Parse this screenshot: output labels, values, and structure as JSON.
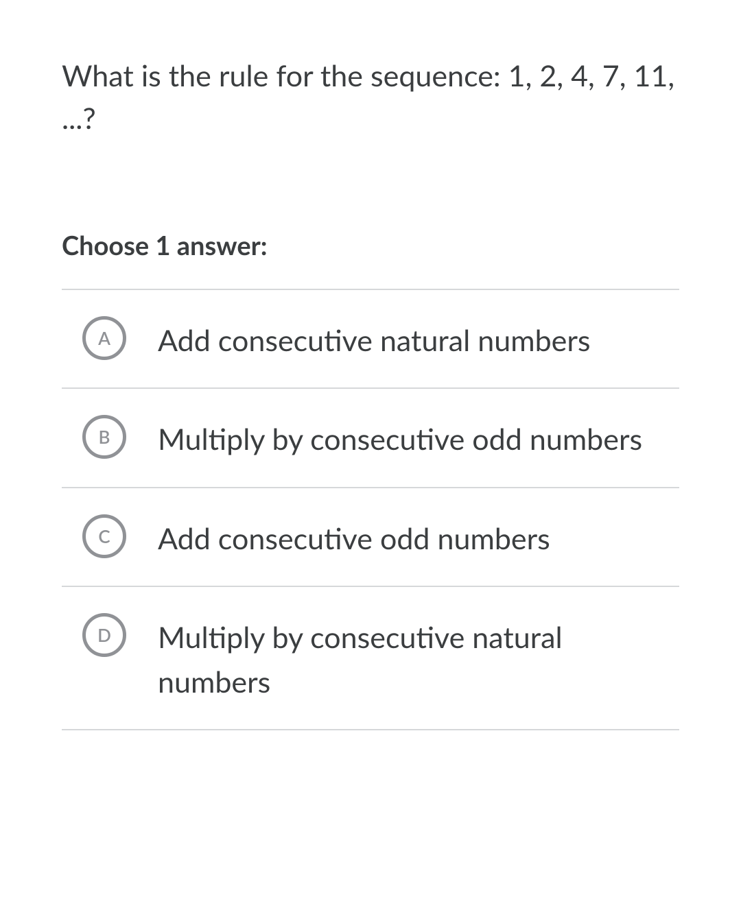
{
  "question": "What is the rule for the sequence: 1, 2, 4, 7, 11, ...?",
  "instruction": "Choose 1 answer:",
  "options": [
    {
      "letter": "A",
      "text": "Add consecutive natural numbers"
    },
    {
      "letter": "B",
      "text": "Multiply by consecutive odd numbers"
    },
    {
      "letter": "C",
      "text": "Add consecutive odd numbers"
    },
    {
      "letter": "D",
      "text": "Multiply by consecutive natural numbers"
    }
  ]
}
